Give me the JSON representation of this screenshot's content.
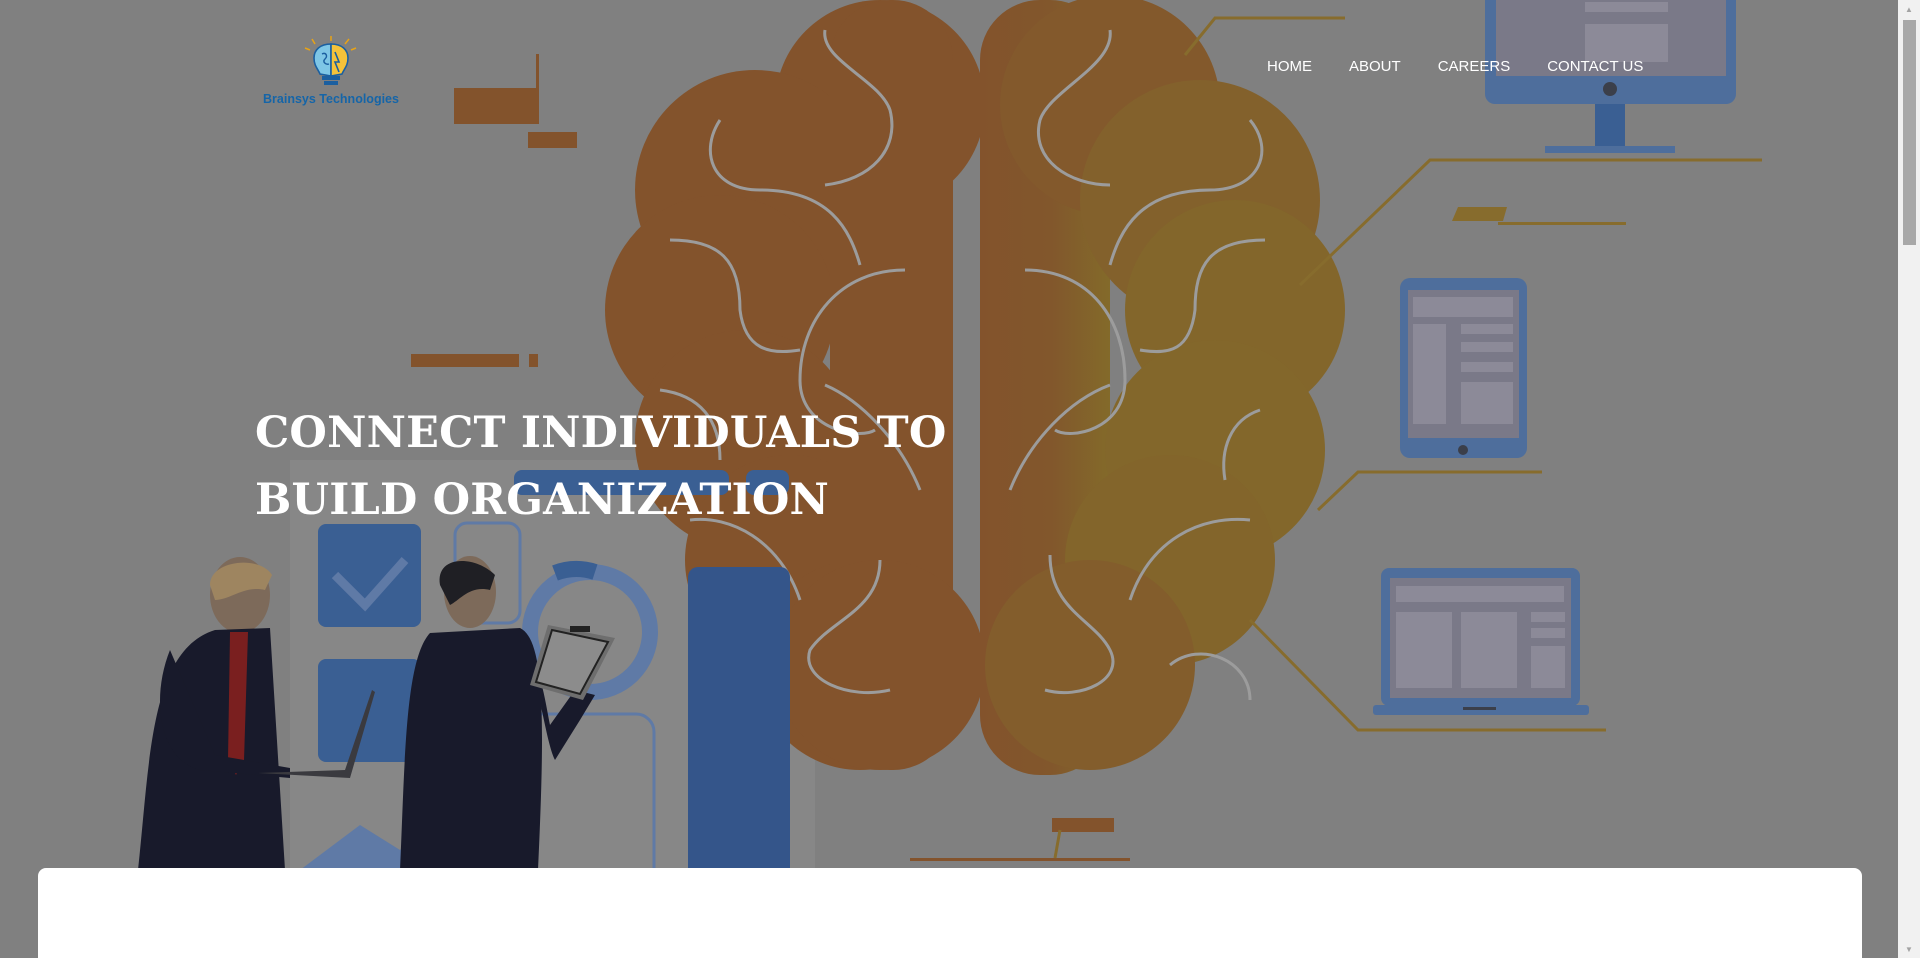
{
  "brand": {
    "name": "Brainsys Technologies",
    "logo_icon": "brain-bulb-icon",
    "color": "#1565a8"
  },
  "nav": {
    "items": [
      "HOME",
      "ABOUT",
      "CAREERS",
      "CONTACT US"
    ]
  },
  "hero": {
    "headline_line1": "CONNECT INDIVIDUALS TO",
    "headline_line2": "BUILD ORGANIZATION",
    "overlay_color": "#808080",
    "accent_color": "#c8832c"
  },
  "scrollbar": {
    "up_icon": "scroll-up-arrow-icon",
    "down_icon": "scroll-down-arrow-icon"
  }
}
